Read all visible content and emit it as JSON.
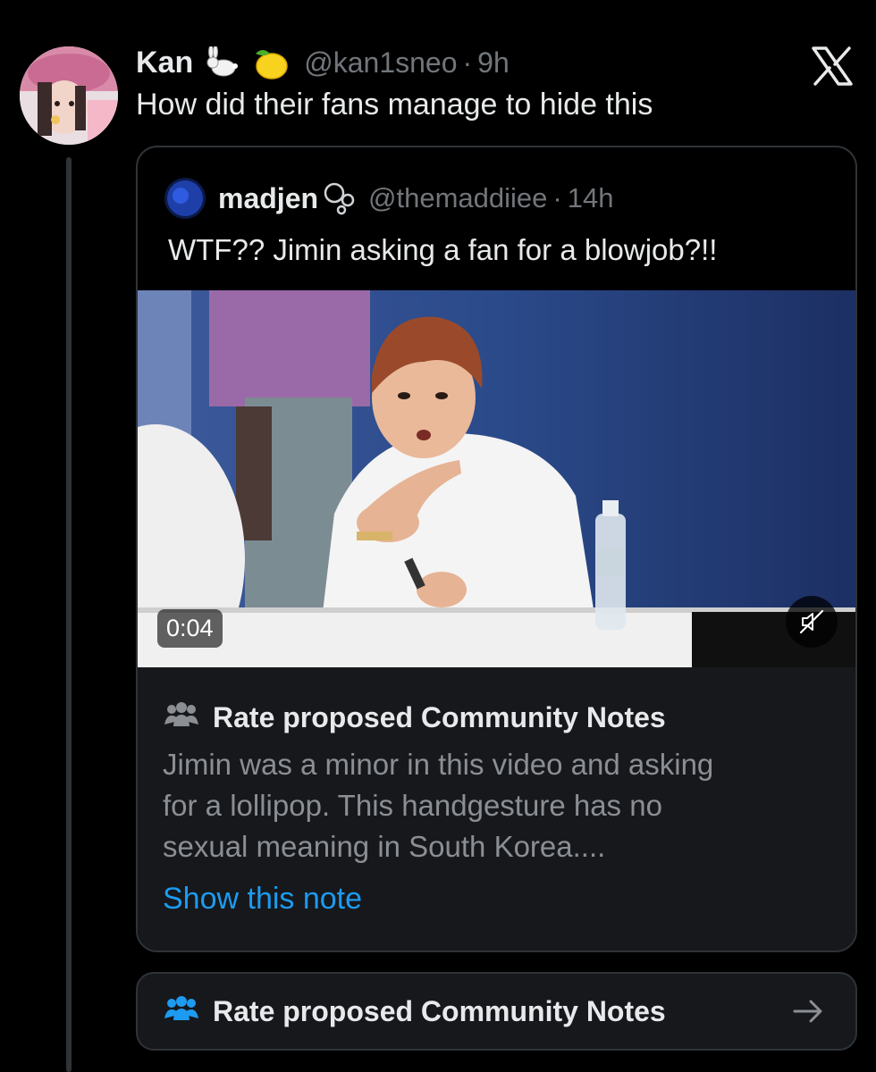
{
  "tweet": {
    "author_name": "Kan",
    "author_handle": "@kan1sneo",
    "separator": "·",
    "timestamp": "9h",
    "text": "How did their fans manage to hide this"
  },
  "quoted": {
    "author_name": "madjen",
    "author_handle": "@themaddiiee",
    "separator": "·",
    "timestamp": "14h",
    "text": "WTF?? Jimin asking a fan for a blowjob?!!",
    "video": {
      "duration": "0:04",
      "muted": true
    },
    "note": {
      "title": "Rate proposed Community Notes",
      "body_lines": [
        "Jimin was a minor in this video and asking",
        "for a lollipop. This handgesture has no",
        "sexual meaning in South Korea...."
      ],
      "link": "Show this note"
    }
  },
  "rate_bar": {
    "label": "Rate proposed Community Notes",
    "icon": "people-icon",
    "arrow_icon": "arrow-right-icon"
  },
  "colors": {
    "background": "#000000",
    "text_primary": "#e7e9ea",
    "text_secondary": "#71767b",
    "link": "#1d9bf0",
    "note_bg": "#16181c",
    "border": "#2f3336"
  }
}
